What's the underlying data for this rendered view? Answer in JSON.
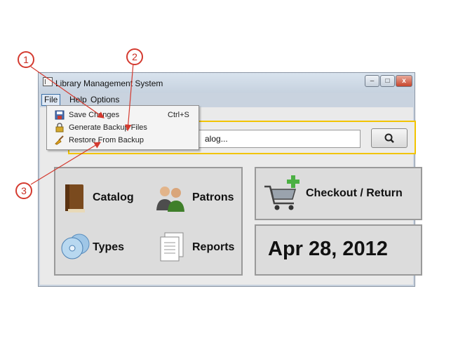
{
  "window": {
    "title": "Library Management System",
    "minimize": "–",
    "maximize": "□",
    "close": "x"
  },
  "menubar": {
    "items": [
      "File",
      "Help",
      "Options"
    ]
  },
  "file_menu": {
    "items": [
      {
        "label": "Save Changes",
        "shortcut": "Ctrl+S",
        "icon": "save-icon"
      },
      {
        "label": "Generate Backup Files",
        "icon": "lock-icon"
      },
      {
        "label": "Restore From Backup",
        "icon": "broom-icon"
      }
    ]
  },
  "search": {
    "visible_text": "alog...",
    "button_icon": "search-icon"
  },
  "tiles": {
    "catalog": "Catalog",
    "patrons": "Patrons",
    "types": "Types",
    "reports": "Reports",
    "checkout": "Checkout / Return"
  },
  "date": "Apr 28, 2012",
  "callouts": [
    "1",
    "2",
    "3"
  ],
  "colors": {
    "callout": "#d43a2f",
    "search_border": "#f2c400",
    "menu_highlight": "#3a6ea5"
  }
}
